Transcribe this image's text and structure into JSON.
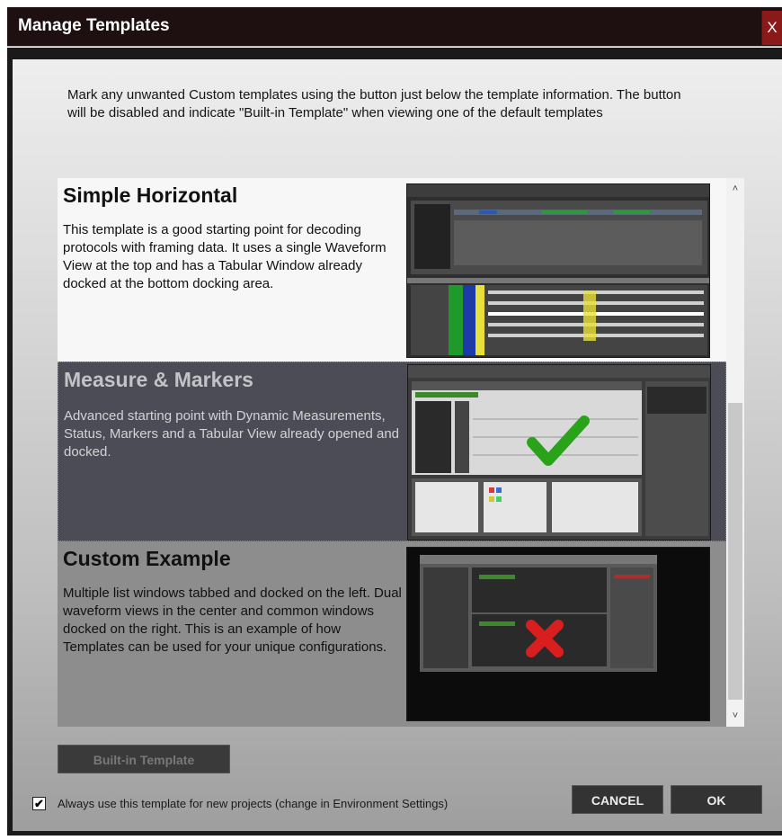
{
  "window": {
    "title": "Manage Templates",
    "close_label": "X"
  },
  "instructions": "Mark any unwanted Custom templates using the button just below the template information. The button will be disabled and indicate \"Built-in Template\" when viewing one of the default templates",
  "templates": [
    {
      "title": "Simple Horizontal",
      "description": "This template is a good starting point for decoding protocols with framing data. It uses a single Waveform View at the top and has a Tabular Window already docked at the bottom docking area.",
      "thumbnail_icon": "simple-horizontal-thumbnail",
      "selected": false
    },
    {
      "title": "Measure & Markers",
      "description": "Advanced starting point with Dynamic Measurements, Status, Markers and a Tabular View already opened and docked.",
      "thumbnail_icon": "measure-markers-thumbnail",
      "overlay_icon": "green-checkmark-icon",
      "selected": true
    },
    {
      "title": "Custom Example",
      "description": "Multiple list windows tabbed and docked on the left. Dual waveform views in the center and common windows docked on the right. This is an example of how Templates can be used for your unique configurations.",
      "thumbnail_icon": "custom-example-thumbnail",
      "overlay_icon": "red-x-icon",
      "selected": false
    }
  ],
  "buttons": {
    "builtin": "Built-in Template",
    "cancel": "CANCEL",
    "ok": "OK"
  },
  "checkbox": {
    "checked": true,
    "label": "Always use this template for new projects (change in Environment Settings)"
  },
  "colors": {
    "titlebar": "#1e1011",
    "selected_item": "#4c4c57",
    "checkmark": "#2aa21a",
    "x_mark": "#d81e1e"
  }
}
